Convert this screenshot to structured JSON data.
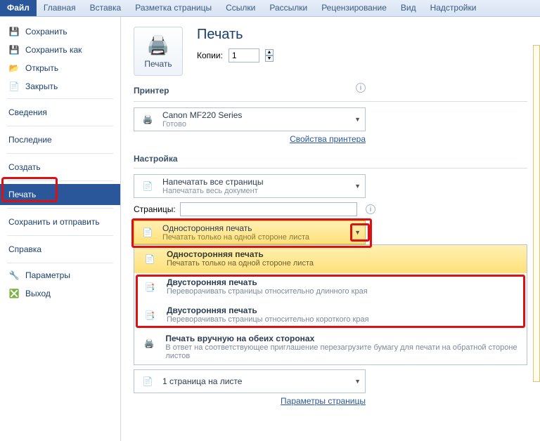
{
  "ribbon": {
    "tabs": [
      "Файл",
      "Главная",
      "Вставка",
      "Разметка страницы",
      "Ссылки",
      "Рассылки",
      "Рецензирование",
      "Вид",
      "Надстройки"
    ]
  },
  "sidebar": {
    "save": "Сохранить",
    "save_as": "Сохранить как",
    "open": "Открыть",
    "close": "Закрыть",
    "info": "Сведения",
    "recent": "Последние",
    "new": "Создать",
    "print": "Печать",
    "send": "Сохранить и отправить",
    "help": "Справка",
    "options": "Параметры",
    "exit": "Выход"
  },
  "print": {
    "heading": "Печать",
    "button": "Печать",
    "copies_label": "Копии:",
    "copies_value": "1"
  },
  "printer": {
    "heading": "Принтер",
    "name": "Canon MF220 Series",
    "status": "Готово",
    "props_link": "Свойства принтера"
  },
  "settings": {
    "heading": "Настройка",
    "scope": {
      "line1": "Напечатать все страницы",
      "line2": "Напечатать весь документ"
    },
    "pages_label": "Страницы:",
    "pages_value": "",
    "duplex_selected": {
      "line1": "Односторонняя печать",
      "line2": "Печатать только на одной стороне листа"
    },
    "duplex_options": [
      {
        "t1": "Односторонняя печать",
        "t2": "Печатать только на одной стороне листа"
      },
      {
        "t1": "Двусторонняя печать",
        "t2": "Переворачивать страницы относительно длинного края"
      },
      {
        "t1": "Двусторонняя печать",
        "t2": "Переворачивать страницы относительно короткого края"
      },
      {
        "t1": "Печать вручную на обеих сторонах",
        "t2": "В ответ на соответствующее приглашение перезагрузите бумагу для печати на обратной стороне листов"
      }
    ],
    "per_sheet": "1 страница на листе",
    "page_params_link": "Параметры страницы"
  }
}
